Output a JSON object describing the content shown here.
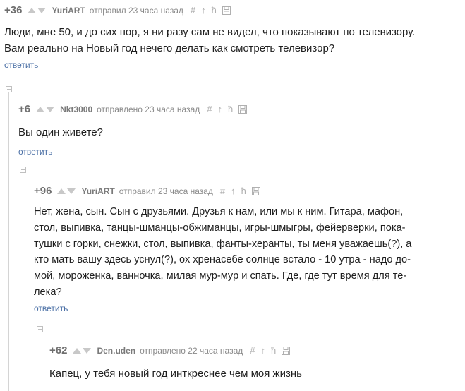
{
  "comments": [
    {
      "score": "+36",
      "author": "YuriART",
      "meta": "отправил 23 часа назад",
      "lines": [
        "Люди, мне 50, и до сих пор, я ни разу сам не видел, что показывают по телевизору.",
        "Вам реально на Новый год нечего делать как смотреть телевизор?"
      ],
      "reply": "ответить"
    },
    {
      "score": "+6",
      "author": "Nkt3000",
      "meta": "отправлено 23 часа назад",
      "lines": [
        "Вы один живете?"
      ],
      "reply": "ответить"
    },
    {
      "score": "+96",
      "author": "YuriART",
      "meta": "отправил 23 часа назад",
      "lines": [
        "Нет, жена, сын. Сын с друзьями. Друзья к нам, или мы к ним. Гитара, мафон,",
        "стол, выпивка, танцы-шманцы-обжиманцы, игры-шмыгры, фейерверки, пока-",
        "тушки с горки, снежки, стол, выпивка, фанты-херанты, ты меня уважаешь(?), а",
        "кто мать вашу здесь уснул(?), ох хренасебе солнце встало - 10 утра - надо до-",
        "мой, мороженка, ванночка, милая мур-мур и спать. Где, где тут время для те-",
        "лека?"
      ],
      "reply": "ответить"
    },
    {
      "score": "+62",
      "author": "Den.uden",
      "meta": "отправлено 22 часа назад",
      "lines": [
        "Капец, у тебя новый год инткреснее чем моя жизнь"
      ]
    }
  ]
}
